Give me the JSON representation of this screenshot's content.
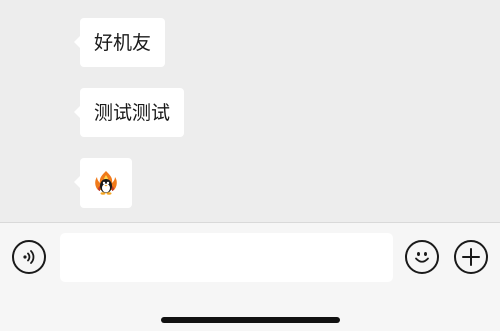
{
  "messages": [
    {
      "type": "text",
      "text": "好机友"
    },
    {
      "type": "text",
      "text": "测试测试"
    },
    {
      "type": "sticker",
      "icon": "penguin-fire-sticker-icon"
    }
  ],
  "input_bar": {
    "voice_icon": "voice-icon",
    "input_value": "",
    "emoji_icon": "emoji-icon",
    "plus_icon": "plus-icon"
  },
  "colors": {
    "background": "#ededed",
    "input_bar_background": "#f6f6f6",
    "bubble": "#ffffff",
    "text": "#1a1a1a"
  }
}
